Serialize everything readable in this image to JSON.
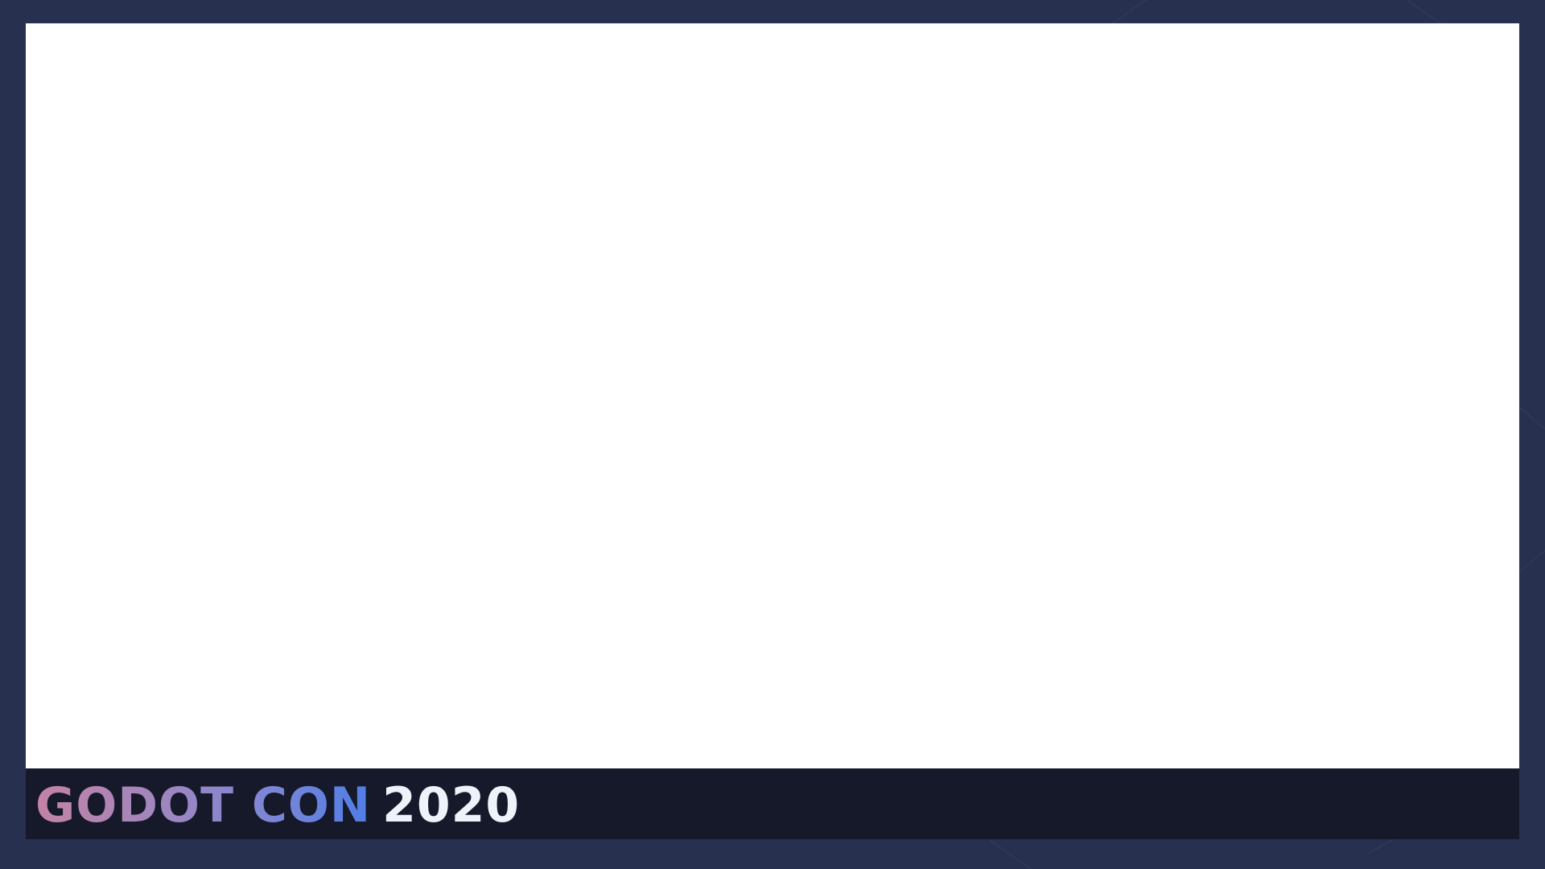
{
  "banner": {
    "title_gradient": "GODOT CON",
    "title_year": "2020"
  },
  "colors": {
    "frame_background": "#283050",
    "footer_background": "#161929",
    "content_background": "#ffffff",
    "gradient_start": "#c383a5",
    "gradient_end": "#4f7de6",
    "year_color": "#eef2fb"
  }
}
